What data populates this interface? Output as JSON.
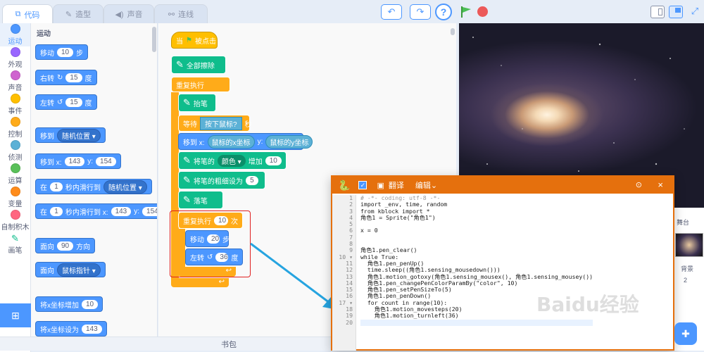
{
  "tabs": [
    {
      "label": "代码",
      "icon": "code-icon"
    },
    {
      "label": "造型",
      "icon": "brush-icon"
    },
    {
      "label": "声音",
      "icon": "speaker-icon"
    },
    {
      "label": "连线",
      "icon": "wire-icon"
    }
  ],
  "toolbar": {
    "undo": "↶",
    "redo": "↷",
    "help": "?"
  },
  "categories": [
    {
      "label": "运动",
      "color": "#4c97ff"
    },
    {
      "label": "外观",
      "color": "#9966ff"
    },
    {
      "label": "声音",
      "color": "#cf63cf"
    },
    {
      "label": "事件",
      "color": "#ffbf00"
    },
    {
      "label": "控制",
      "color": "#ffab19"
    },
    {
      "label": "侦测",
      "color": "#5cb1d6"
    },
    {
      "label": "运算",
      "color": "#59c059"
    },
    {
      "label": "变量",
      "color": "#ff8c1a"
    },
    {
      "label": "自制积木",
      "color": "#ff6680"
    },
    {
      "label": "画笔",
      "color": "#0fbd8c"
    }
  ],
  "palette": {
    "title": "运动",
    "move": {
      "a": "移动",
      "v": "10",
      "b": "步"
    },
    "turn_right": {
      "a": "右转",
      "v": "15",
      "b": "度"
    },
    "turn_left": {
      "a": "左转",
      "v": "15",
      "b": "度"
    },
    "goto": {
      "a": "移到",
      "dd": "随机位置"
    },
    "goto_xy": {
      "a": "移到 x:",
      "x": "143",
      "yl": "y:",
      "y": "154"
    },
    "glide": {
      "a": "在",
      "v": "1",
      "b": "秒内滑行到",
      "dd": "随机位置"
    },
    "glide_xy": {
      "a": "在",
      "v": "1",
      "b": "秒内滑行到 x:",
      "x": "143",
      "yl": "y:",
      "y": "154"
    },
    "point": {
      "a": "面向",
      "v": "90",
      "b": "方向"
    },
    "point_towards": {
      "a": "面向",
      "dd": "鼠标指针"
    },
    "change_x": {
      "a": "将x坐标增加",
      "v": "10"
    },
    "set_x": {
      "a": "将x坐标设为",
      "v": "143"
    }
  },
  "script": {
    "hat": {
      "a": "当",
      "b": "被点击"
    },
    "clear": "全部擦除",
    "forever": "重复执行",
    "pen_up": "抬笔",
    "wait": {
      "a": "等待",
      "cond": "按下鼠标?",
      "b": "秒"
    },
    "goto": {
      "a": "移到 x:",
      "x": "鼠标的x坐标",
      "yl": "y:",
      "y": "鼠标的y坐标"
    },
    "change_color": {
      "a": "将笔的",
      "dd": "颜色",
      "b": "增加",
      "v": "10"
    },
    "set_size": {
      "a": "将笔的粗细设为",
      "v": "5"
    },
    "pen_down": "落笔",
    "repeat": {
      "a": "重复执行",
      "v": "10",
      "b": "次"
    },
    "move": {
      "a": "移动",
      "v": "20",
      "b": "步"
    },
    "turn": {
      "a": "左转",
      "v": "36",
      "b": "度"
    }
  },
  "bottom": {
    "label": "书包"
  },
  "sprite_panel": {
    "stage_label": "舞台",
    "backdrop_label": "背景",
    "backdrop_count": "2"
  },
  "python": {
    "title": "翻译",
    "edit": "编辑",
    "lines": [
      "# -*- coding: utf-8 -*-",
      "import _env, time, random",
      "from kblock import *",
      "角色1 = Sprite(\"角色1\")",
      "",
      "x = 0",
      "",
      "",
      "角色1.pen_clear()",
      "while True:",
      "  角色1.pen_penUp()",
      "  time.sleep((角色1.sensing_mousedown()))",
      "  角色1.motion_gotoxy(角色1.sensing_mousex(), 角色1.sensing_mousey())",
      "  角色1.pen_changePenColorParamBy(\"color\", 10)",
      "  角色1.pen_setPenSizeTo(5)",
      "  角色1.pen_penDown()",
      "  for count in range(10):",
      "    角色1.motion_movesteps(20)",
      "    角色1.motion_turnleft(36)",
      ""
    ]
  },
  "watermark": "Baidu经验"
}
